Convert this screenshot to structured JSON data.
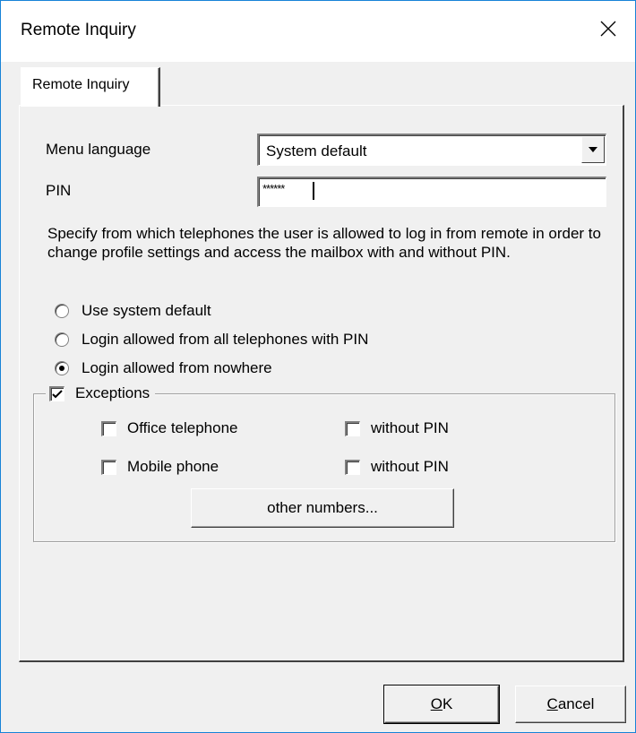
{
  "window": {
    "title": "Remote Inquiry",
    "close_icon": "close-icon"
  },
  "tabs": [
    {
      "label": "Remote Inquiry",
      "selected": true
    }
  ],
  "form": {
    "menu_language": {
      "label": "Menu language",
      "value": "System default"
    },
    "pin": {
      "label": "PIN",
      "value": "******"
    },
    "description": "Specify from which telephones the user is allowed to log in from remote in order to change profile settings and access the mailbox with and without PIN.",
    "login_options": [
      {
        "label": "Use system default",
        "selected": false
      },
      {
        "label": "Login allowed from all telephones with PIN",
        "selected": false
      },
      {
        "label": "Login allowed from nowhere",
        "selected": true
      }
    ],
    "exceptions": {
      "label": "Exceptions",
      "checked": true,
      "office_telephone": {
        "label": "Office telephone",
        "checked": false
      },
      "office_without_pin": {
        "label": "without PIN",
        "checked": false
      },
      "mobile_phone": {
        "label": "Mobile phone",
        "checked": false
      },
      "mobile_without_pin": {
        "label": "without PIN",
        "checked": false
      },
      "other_numbers_label": "other numbers..."
    }
  },
  "footer": {
    "ok_mnemonic": "O",
    "ok_rest": "K",
    "cancel_mnemonic": "C",
    "cancel_rest": "ancel"
  }
}
